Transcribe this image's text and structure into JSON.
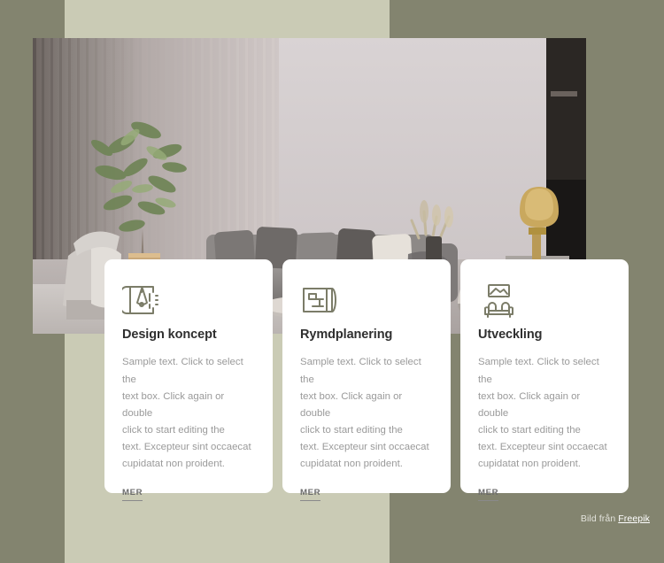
{
  "theme": {
    "outer_background": "#83846f",
    "inner_panel": "#cacbb5",
    "card_background": "#ffffff",
    "icon_color": "#7b7c68",
    "title_color": "#2f2f2f",
    "body_color": "#9a9a9a",
    "link_color": "#6b6b6b"
  },
  "hero": {
    "alt": "Modern living room interior with grey sectional sofa, olive tree, fluted wall panelling and gold table lamp"
  },
  "cards": [
    {
      "icon": "blueprint-compass-icon",
      "title": "Design koncept",
      "body": "Sample text. Click to select the\ntext box. Click again or double\nclick to start editing the\ntext. Excepteur sint occaecat\ncupidatat non proident.",
      "link_label": "MER"
    },
    {
      "icon": "floor-plan-icon",
      "title": "Rymdplanering",
      "body": "Sample text. Click to select the\ntext box. Click again or double\nclick to start editing the\ntext. Excepteur sint occaecat\ncupidatat non proident.",
      "link_label": "MER"
    },
    {
      "icon": "sofa-picture-frame-icon",
      "title": "Utveckling",
      "body": "Sample text. Click to select the\ntext box. Click again or double\nclick to start editing the\ntext. Excepteur sint occaecat\ncupidatat non proident.",
      "link_label": "MER"
    }
  ],
  "credit": {
    "prefix": "Bild från ",
    "link_label": "Freepik"
  }
}
